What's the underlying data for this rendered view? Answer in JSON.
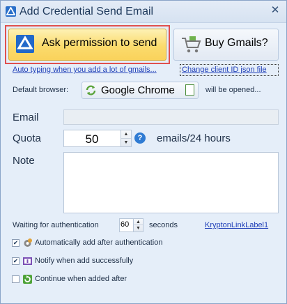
{
  "window": {
    "title": "Add Credential Send Email",
    "close_glyph": "✕"
  },
  "buttons": {
    "ask_permission": "Ask permission to send",
    "buy_gmails": "Buy Gmails?",
    "browser": "Google Chrome"
  },
  "links": {
    "auto_typing": "Auto typing when you add a lot of gmails...",
    "change_client_id": "Change client ID json file",
    "krypton": "KryptonLinkLabel1"
  },
  "browser_row": {
    "prefix": "Default browser:",
    "suffix": "will be opened..."
  },
  "form": {
    "email_label": "Email",
    "email_value": "",
    "quota_label": "Quota",
    "quota_value": "50",
    "quota_unit": "emails/24 hours",
    "note_label": "Note",
    "note_value": ""
  },
  "waiting": {
    "label": "Waiting for authentication",
    "value": "60",
    "unit": "seconds"
  },
  "options": [
    {
      "label": "Automatically add after authentication",
      "checked": true
    },
    {
      "label": "Notify when add successfully",
      "checked": true
    },
    {
      "label": "Continue when added after",
      "checked": false
    }
  ],
  "icons": {
    "app": "app-logo-icon",
    "ask": "drive-logo-icon",
    "buy": "shopping-cart-icon",
    "browser": "chrome-refresh-icon",
    "doc": "document-icon",
    "help": "help-icon",
    "help_glyph": "?"
  },
  "colors": {
    "highlight_border": "#e0504f",
    "ask_button": "#fbdb6d",
    "link": "#1f3fb8",
    "window_bg": "#e5eef9"
  }
}
